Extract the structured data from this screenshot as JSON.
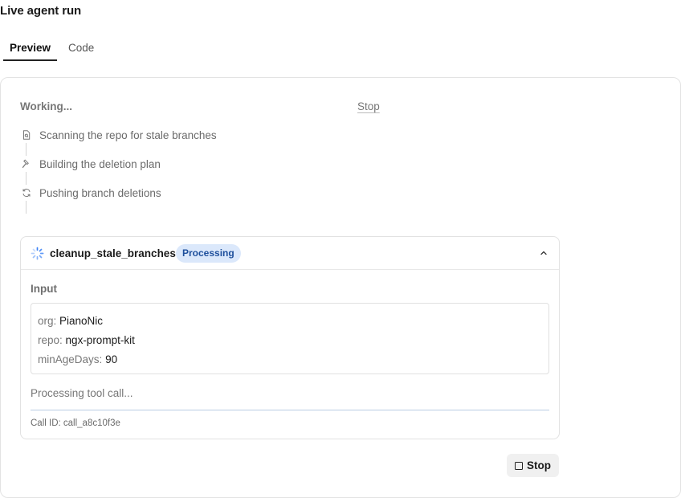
{
  "header": {
    "title": "Live agent run"
  },
  "tabs": [
    {
      "label": "Preview",
      "active": true
    },
    {
      "label": "Code",
      "active": false
    }
  ],
  "status": {
    "working_label": "Working...",
    "stop_link_label": "Stop"
  },
  "steps": [
    {
      "icon": "document-search-icon",
      "label": "Scanning the repo for stale branches"
    },
    {
      "icon": "hammer-icon",
      "label": "Building the deletion plan"
    },
    {
      "icon": "refresh-icon",
      "label": "Pushing branch deletions"
    }
  ],
  "tool_call": {
    "name": "cleanup_stale_branches",
    "badge": "Processing",
    "input_heading": "Input",
    "inputs": [
      {
        "key": "org:",
        "value": "PianoNic"
      },
      {
        "key": "repo:",
        "value": "ngx-prompt-kit"
      },
      {
        "key": "minAgeDays:",
        "value": "90"
      }
    ],
    "processing_text": "Processing tool call...",
    "call_id": "Call ID: call_a8c10f3e"
  },
  "actions": {
    "stop_button_label": "Stop"
  },
  "colors": {
    "badge_bg": "#dbe8fb",
    "badge_text": "#1e4f9c",
    "spinner": "#3b82f6"
  }
}
